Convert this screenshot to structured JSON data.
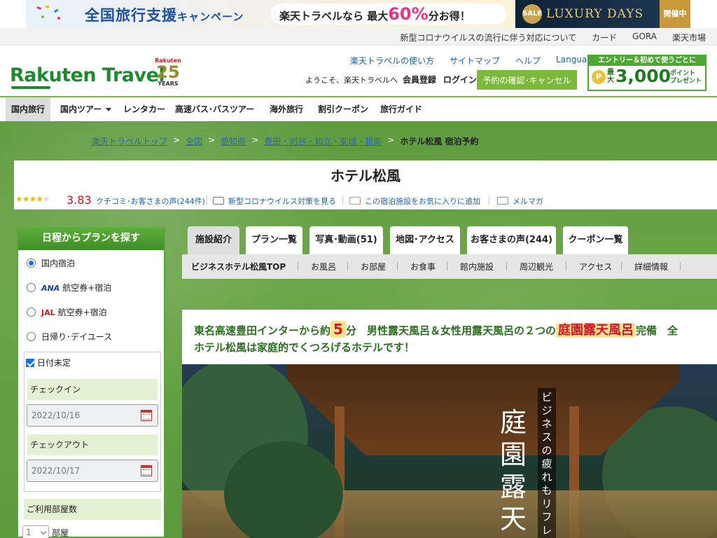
{
  "banner": {
    "campaign_title": "全国旅行支援",
    "campaign_suffix": "キャンペーン",
    "pill_prefix": "楽天トラベルなら 最大",
    "pill_percent": "60%",
    "pill_suffix": "分お得！",
    "sale_badge": "SALE",
    "luxury": "LUXURY DAYS",
    "luxury_status": "開催中"
  },
  "topstrip": {
    "links": [
      "新型コロナウイルスの流行に伴う対応について",
      "カード",
      "GORA",
      "楽天市場"
    ]
  },
  "header": {
    "logo": "Rakuten Travel",
    "anniv_brand": "Rakuten",
    "anniv_num": "25",
    "anniv_years": "YEARS",
    "links": [
      "楽天トラベルの使い方",
      "サイトマップ",
      "ヘルプ",
      "Languages"
    ],
    "welcome": "ようこそ、楽天トラベルへ",
    "register": "会員登録",
    "login": "ログイン",
    "reservation_btn": "予約の確認･キャンセル",
    "entry_top": "エントリー＆初めて使うごとに",
    "entry_coin": "P",
    "entry_max": "最大",
    "entry_num": "3,000",
    "entry_point": "ポイント",
    "entry_present": "プレゼント"
  },
  "nav": {
    "items": [
      "国内旅行",
      "国内ツアー",
      "レンタカー",
      "高速バス･バスツアー",
      "海外旅行",
      "割引クーポン",
      "旅行ガイド"
    ]
  },
  "breadcrumb": {
    "items": [
      "楽天トラベルトップ",
      "全国",
      "愛知県",
      "豊田・刈谷・知立・安城・碧南"
    ],
    "sep": ">",
    "current": "ホテル松風 宿泊予約"
  },
  "hotel": {
    "name": "ホテル松風",
    "stars_full": "★★★★",
    "stars_empty": "★",
    "score": "3.83",
    "reviews": "クチコミ･お客さまの声(244件)",
    "links": [
      "新型コロナウイルス対策を見る",
      "この宿泊施設をお気に入りに追加",
      "メルマガ"
    ]
  },
  "sidebar": {
    "title": "日程からプランを探す",
    "options": [
      "国内宿泊",
      "航空券+宿泊",
      "航空券+宿泊",
      "日帰り･デイユース"
    ],
    "ana": "ANA",
    "jal": "JAL",
    "date_undecided": "日付未定",
    "checkin_label": "チェックイン",
    "checkin_value": "2022/10/16",
    "checkout_label": "チェックアウト",
    "checkout_value": "2022/10/17",
    "rooms_label": "ご利用部屋数",
    "rooms_value": "1",
    "rooms_unit": "部屋"
  },
  "tabs": [
    "施設紹介",
    "プラン一覧",
    "写真･動画(51)",
    "地図･アクセス",
    "お客さまの声(244)",
    "クーポン一覧"
  ],
  "subnav": [
    "ビジネスホテル松風TOP",
    "お風呂",
    "お部屋",
    "お食事",
    "館内施設",
    "周辺観光",
    "アクセス",
    "詳細情報"
  ],
  "content": {
    "catch_a": "東名高速豊田インターから約",
    "catch_num": "5",
    "catch_b": "分　男性露天風呂＆女性用露天風呂の２つの",
    "catch_highlight": "庭園露天風呂",
    "catch_c": "完備　全",
    "catch_line2": "ホテル松風は家庭的でくつろげるホテルです！",
    "hero_title": "庭園露天",
    "hero_sub": "ビジネスの疲れもリフレッシュ"
  },
  "colors": {
    "brand_green": "#1e8a2e",
    "accent_green": "#77b934",
    "score_red": "#c8161d"
  }
}
